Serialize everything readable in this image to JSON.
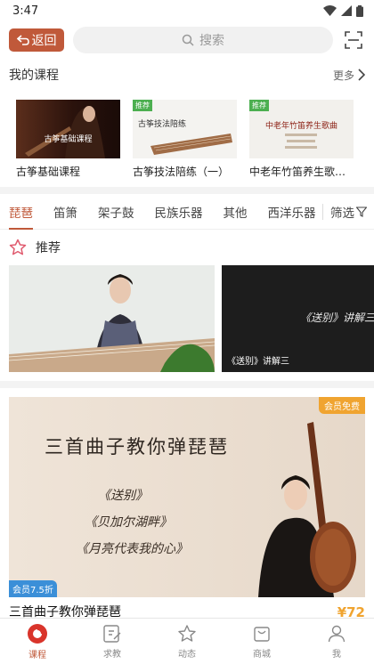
{
  "status_bar": {
    "time": "3:47"
  },
  "header": {
    "back_label": "返回",
    "search_placeholder": "搜索"
  },
  "my_courses": {
    "title": "我的课程",
    "more_label": "更多",
    "items": [
      {
        "title": "古筝基础课程",
        "thumb_text": "古筝基础课程",
        "badge": ""
      },
      {
        "title": "古筝技法陪练（一）",
        "thumb_text": "古筝技法陪练",
        "badge": "推荐"
      },
      {
        "title": "中老年竹笛养生歌曲...",
        "thumb_text": "中老年竹笛养生歌曲",
        "badge": "推荐"
      }
    ]
  },
  "tabs": {
    "items": [
      "琵琶",
      "笛箫",
      "架子鼓",
      "民族乐器",
      "其他",
      "西洋乐器"
    ],
    "active_index": 0,
    "filter_label": "筛选"
  },
  "recommend": {
    "title": "推荐",
    "videos": [
      {
        "caption": ""
      },
      {
        "caption": "《送别》讲解三",
        "center_text": "《送别》讲解三"
      }
    ]
  },
  "banner": {
    "title": "三首曲子教你弹琵琶",
    "lines": [
      "《送别》",
      "《贝加尔湖畔》",
      "《月亮代表我的心》"
    ],
    "member_free_label": "会员免费",
    "member_discount_label": "会员7.5折",
    "caption": "三首曲子教你弹琵琶",
    "price": "¥72"
  },
  "bottom_nav": {
    "items": [
      {
        "label": "课程",
        "icon": "course-icon"
      },
      {
        "label": "求教",
        "icon": "edit-icon"
      },
      {
        "label": "动态",
        "icon": "star-icon"
      },
      {
        "label": "商城",
        "icon": "shop-icon"
      },
      {
        "label": "我",
        "icon": "user-icon"
      }
    ],
    "active_index": 0
  },
  "colors": {
    "accent": "#c0593a",
    "badge_orange": "#f0a430",
    "badge_blue": "#3b8fd8"
  }
}
